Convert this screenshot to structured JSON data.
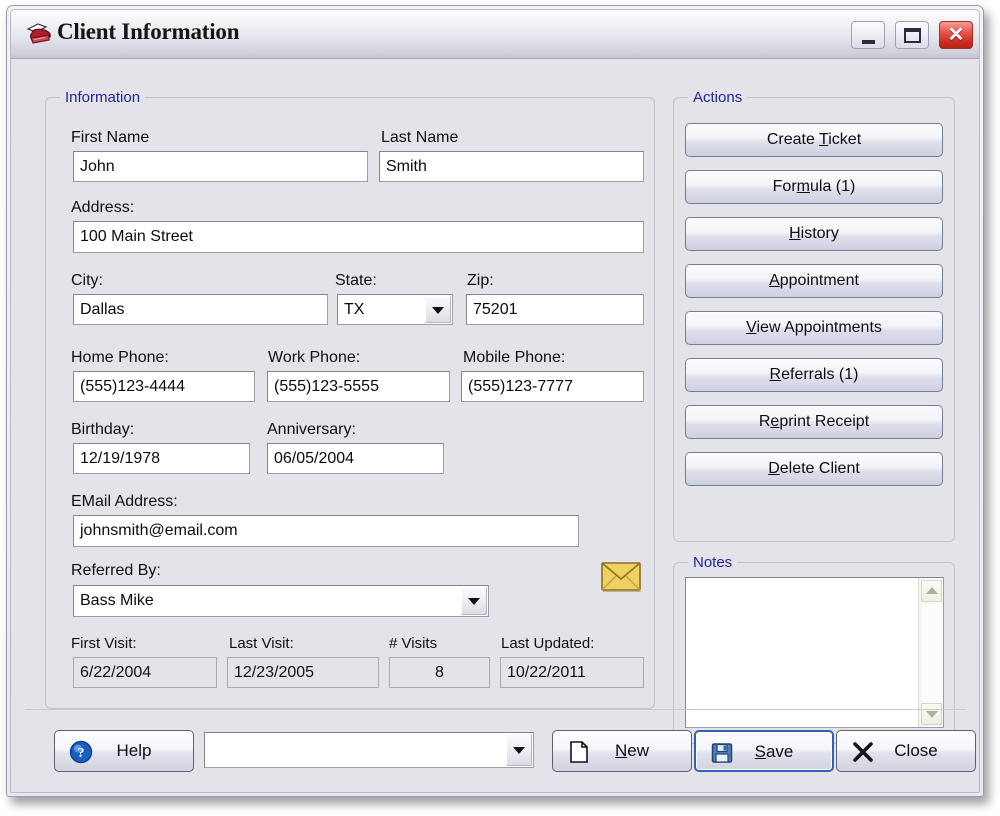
{
  "window": {
    "title": "Client Information",
    "icon": "card-file-icon",
    "min_label": "Minimize",
    "max_label": "Maximize",
    "close_label": "✕"
  },
  "information": {
    "group_title": "Information",
    "first_name": {
      "label": "First Name",
      "value": "John"
    },
    "last_name": {
      "label": "Last Name",
      "value": "Smith"
    },
    "address": {
      "label": "Address:",
      "value": "100 Main Street"
    },
    "city": {
      "label": "City:",
      "value": "Dallas"
    },
    "state": {
      "label": "State:",
      "value": "TX"
    },
    "zip": {
      "label": "Zip:",
      "value": "75201"
    },
    "home_phone": {
      "label": "Home Phone:",
      "value": "(555)123-4444"
    },
    "work_phone": {
      "label": "Work Phone:",
      "value": "(555)123-5555"
    },
    "mobile_phone": {
      "label": "Mobile Phone:",
      "value": "(555)123-7777"
    },
    "birthday": {
      "label": "Birthday:",
      "value": "12/19/1978"
    },
    "anniversary": {
      "label": "Anniversary:",
      "value": "06/05/2004"
    },
    "email": {
      "label": "EMail Address:",
      "value": "johnsmith@email.com"
    },
    "referred_by": {
      "label": "Referred By:",
      "value": "Bass Mike"
    },
    "first_visit": {
      "label": "First Visit:",
      "value": "6/22/2004"
    },
    "last_visit": {
      "label": "Last Visit:",
      "value": "12/23/2005"
    },
    "num_visits": {
      "label": "# Visits",
      "value": "8"
    },
    "last_updated": {
      "label": "Last Updated:",
      "value": "10/22/2011"
    },
    "email_icon": "envelope-icon"
  },
  "actions": {
    "group_title": "Actions",
    "buttons": [
      {
        "prefix": "Create ",
        "accel": "T",
        "suffix": "icket"
      },
      {
        "prefix": "For",
        "accel": "m",
        "suffix": "ula (1)"
      },
      {
        "prefix": "",
        "accel": "H",
        "suffix": "istory"
      },
      {
        "prefix": "",
        "accel": "A",
        "suffix": "ppointment"
      },
      {
        "prefix": "",
        "accel": "V",
        "suffix": "iew Appointments"
      },
      {
        "prefix": "",
        "accel": "R",
        "suffix": "eferrals (1)"
      },
      {
        "prefix": "R",
        "accel": "e",
        "suffix": "print Receipt"
      },
      {
        "prefix": "",
        "accel": "D",
        "suffix": "elete Client"
      }
    ]
  },
  "notes": {
    "group_title": "Notes",
    "value": "",
    "placeholder": ""
  },
  "footer": {
    "help": {
      "label": "Help",
      "icon": "help-question-icon"
    },
    "selector": {
      "value": "",
      "placeholder": ""
    },
    "new": {
      "prefix": "",
      "accel": "N",
      "suffix": "ew",
      "icon": "new-page-icon"
    },
    "save": {
      "prefix": "",
      "accel": "S",
      "suffix": "ave",
      "icon": "save-floppy-icon"
    },
    "close": {
      "prefix": "Close",
      "accel": "",
      "suffix": "",
      "icon": "close-x-icon"
    }
  },
  "colors": {
    "group_title": "#232398",
    "window_bg": "#e3e3e9",
    "accent_focus": "#2f62b0",
    "close_red": "#cf2d22"
  }
}
